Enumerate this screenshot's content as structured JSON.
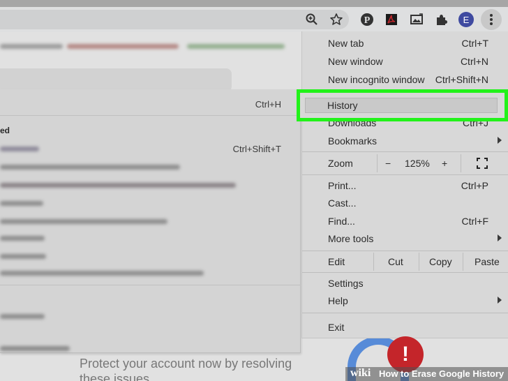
{
  "toolbar": {
    "icons": [
      "zoom-icon",
      "bookmark-star-icon",
      "pinterest-icon",
      "pdf-icon",
      "screenshot-icon",
      "extensions-puzzle-icon",
      "profile-avatar",
      "more-menu-icon"
    ],
    "profile_initial": "E"
  },
  "submenu": {
    "history_shortcut": "Ctrl+H",
    "recently_closed_fragment": "ed",
    "reopen_shortcut": "Ctrl+Shift+T"
  },
  "page": {
    "line1": "Protect your account now by resolving",
    "line2": "these issues"
  },
  "menu": {
    "new_tab": {
      "label": "New tab",
      "shortcut": "Ctrl+T"
    },
    "new_window": {
      "label": "New window",
      "shortcut": "Ctrl+N"
    },
    "new_incognito": {
      "label": "New incognito window",
      "shortcut": "Ctrl+Shift+N"
    },
    "history": {
      "label": "History"
    },
    "downloads": {
      "label": "Downloads",
      "shortcut": "Ctrl+J"
    },
    "bookmarks": {
      "label": "Bookmarks"
    },
    "zoom": {
      "label": "Zoom",
      "minus": "−",
      "value": "125%",
      "plus": "+"
    },
    "print": {
      "label": "Print...",
      "shortcut": "Ctrl+P"
    },
    "cast": {
      "label": "Cast..."
    },
    "find": {
      "label": "Find...",
      "shortcut": "Ctrl+F"
    },
    "more_tools": {
      "label": "More tools"
    },
    "edit": {
      "label": "Edit",
      "cut": "Cut",
      "copy": "Copy",
      "paste": "Paste"
    },
    "settings": {
      "label": "Settings"
    },
    "help": {
      "label": "Help"
    },
    "exit": {
      "label": "Exit"
    }
  },
  "highlight_color": "#22f21a",
  "watermark": {
    "logo": "wiki",
    "text": "How to Erase Google History"
  }
}
